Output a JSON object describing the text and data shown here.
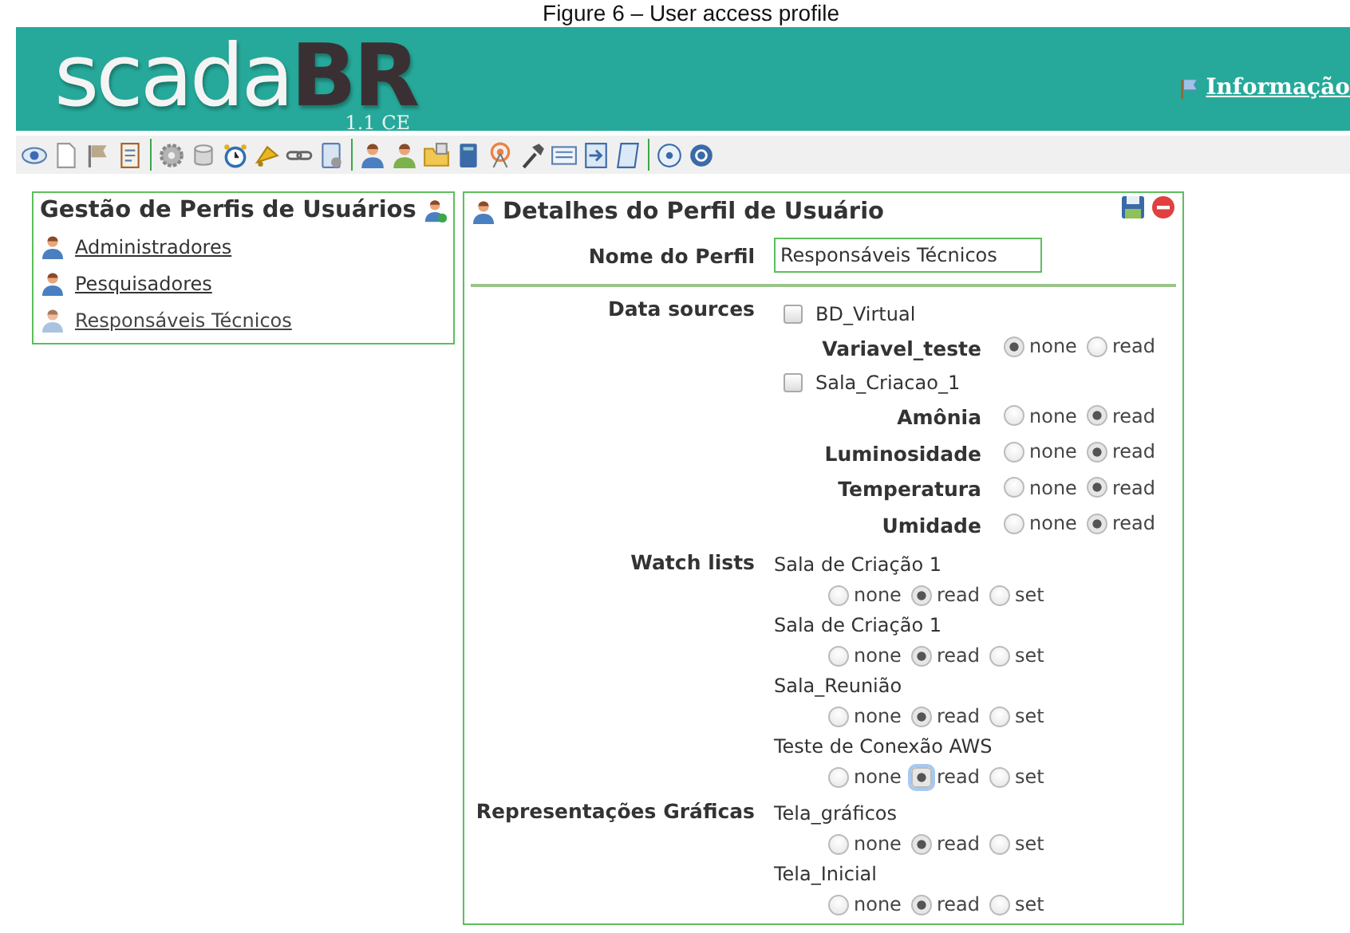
{
  "caption": "Figure 6 – User access profile",
  "header": {
    "logo_main": "scada",
    "logo_accent": "BR",
    "version": "1.1 CE",
    "link": "Informação"
  },
  "profiles_panel": {
    "title": "Gestão de Perfis de Usuários",
    "items": [
      {
        "label": "Administradores",
        "selected": false
      },
      {
        "label": "Pesquisadores",
        "selected": false
      },
      {
        "label": "Responsáveis Técnicos",
        "selected": true
      }
    ]
  },
  "details_panel": {
    "title": "Detalhes do Perfil de Usuário",
    "name_label": "Nome do Perfil",
    "name_value": "Responsáveis Técnicos",
    "sections": [
      {
        "label": "Data sources",
        "kind": "datasources",
        "groups": [
          {
            "name": "BD_Virtual",
            "checked": false,
            "points": [
              {
                "name": "Variavel_teste",
                "options": [
                  {
                    "label": "none",
                    "selected": true
                  },
                  {
                    "label": "read",
                    "selected": false
                  }
                ]
              }
            ]
          },
          {
            "name": "Sala_Criacao_1",
            "checked": false,
            "points": [
              {
                "name": "Amônia",
                "options": [
                  {
                    "label": "none",
                    "selected": false
                  },
                  {
                    "label": "read",
                    "selected": true
                  }
                ]
              },
              {
                "name": "Luminosidade",
                "options": [
                  {
                    "label": "none",
                    "selected": false
                  },
                  {
                    "label": "read",
                    "selected": true
                  }
                ]
              },
              {
                "name": "Temperatura",
                "options": [
                  {
                    "label": "none",
                    "selected": false
                  },
                  {
                    "label": "read",
                    "selected": true
                  }
                ]
              },
              {
                "name": "Umidade",
                "options": [
                  {
                    "label": "none",
                    "selected": false
                  },
                  {
                    "label": "read",
                    "selected": true
                  }
                ]
              }
            ]
          }
        ]
      },
      {
        "label": "Watch lists",
        "kind": "lists",
        "items": [
          {
            "name": "Sala de Criação 1",
            "options": [
              {
                "label": "none",
                "selected": false,
                "focused": false
              },
              {
                "label": "read",
                "selected": true,
                "focused": false
              },
              {
                "label": "set",
                "selected": false,
                "focused": false
              }
            ]
          },
          {
            "name": "Sala de Criação 1",
            "options": [
              {
                "label": "none",
                "selected": false,
                "focused": false
              },
              {
                "label": "read",
                "selected": true,
                "focused": false
              },
              {
                "label": "set",
                "selected": false,
                "focused": false
              }
            ]
          },
          {
            "name": "Sala_Reunião",
            "options": [
              {
                "label": "none",
                "selected": false,
                "focused": false
              },
              {
                "label": "read",
                "selected": true,
                "focused": false
              },
              {
                "label": "set",
                "selected": false,
                "focused": false
              }
            ]
          },
          {
            "name": "Teste de Conexão AWS",
            "options": [
              {
                "label": "none",
                "selected": false,
                "focused": false
              },
              {
                "label": "read",
                "selected": true,
                "focused": true
              },
              {
                "label": "set",
                "selected": false,
                "focused": false
              }
            ]
          }
        ]
      },
      {
        "label": "Representações Gráficas",
        "kind": "lists",
        "items": [
          {
            "name": "Tela_gráficos",
            "options": [
              {
                "label": "none",
                "selected": false,
                "focused": false
              },
              {
                "label": "read",
                "selected": true,
                "focused": false
              },
              {
                "label": "set",
                "selected": false,
                "focused": false
              }
            ]
          },
          {
            "name": "Tela_Inicial",
            "options": [
              {
                "label": "none",
                "selected": false,
                "focused": false
              },
              {
                "label": "read",
                "selected": true,
                "focused": false
              },
              {
                "label": "set",
                "selected": false,
                "focused": false
              }
            ]
          }
        ]
      }
    ]
  }
}
